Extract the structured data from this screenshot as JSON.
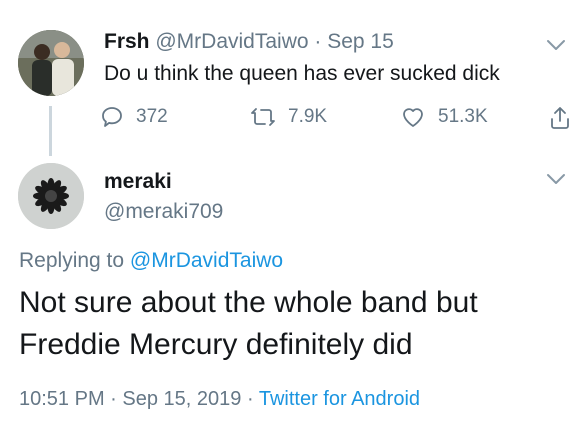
{
  "parent_tweet": {
    "display_name": "Frsh",
    "handle": "@MrDavidTaiwo",
    "separator": "·",
    "date": "Sep 15",
    "text": "Do u think the queen has ever sucked dick",
    "replies": "372",
    "retweets": "7.9K",
    "likes": "51.3K"
  },
  "reply_tweet": {
    "display_name": "meraki",
    "handle": "@meraki709",
    "replying_prefix": "Replying to",
    "replying_handle": "@MrDavidTaiwo",
    "text": "Not sure about the whole band but Freddie Mercury definitely did",
    "time": "10:51 PM",
    "separator1": "·",
    "date": "Sep 15, 2019",
    "separator2": "·",
    "source": "Twitter for Android"
  },
  "colors": {
    "text": "#14171a",
    "muted": "#657786",
    "link": "#1b95e0",
    "thread_line": "#ccd6dd"
  },
  "icons": [
    "reply-icon",
    "retweet-icon",
    "like-icon",
    "share-icon",
    "chevron-down-icon"
  ]
}
